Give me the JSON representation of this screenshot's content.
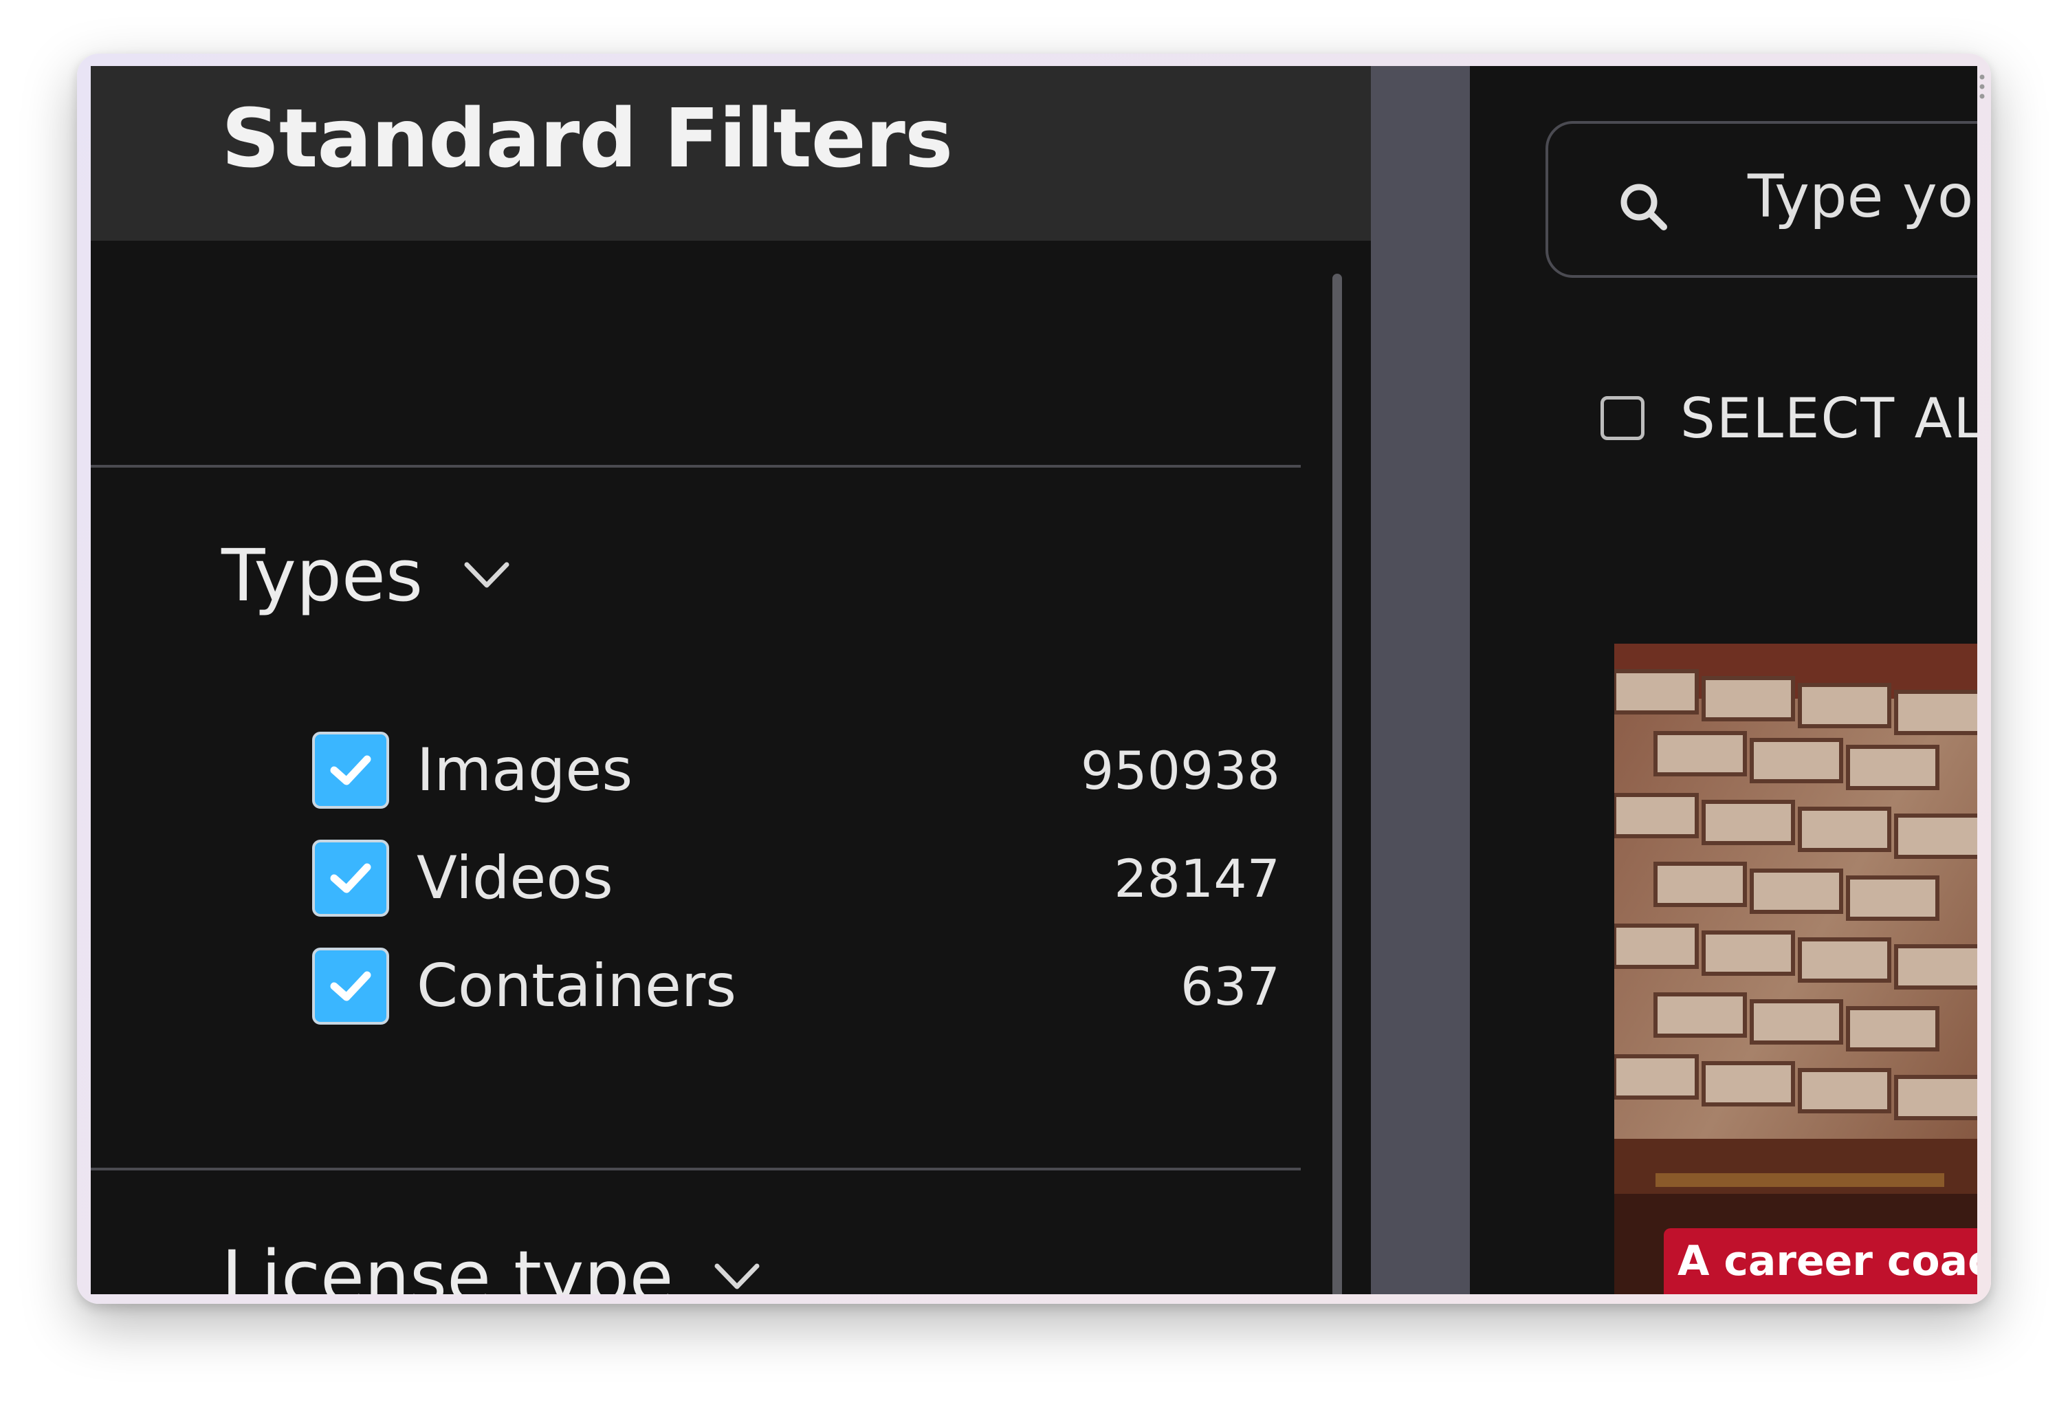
{
  "filters": {
    "title": "Standard Filters",
    "sections": [
      {
        "title": "Types",
        "items": [
          {
            "label": "Images",
            "count": "950938",
            "checked": true
          },
          {
            "label": "Videos",
            "count": "28147",
            "checked": true
          },
          {
            "label": "Containers",
            "count": "637",
            "checked": true
          }
        ]
      },
      {
        "title": "License type"
      }
    ]
  },
  "search": {
    "placeholder": "Type you",
    "icon": "search-icon"
  },
  "selection": {
    "select_all_label": "SELECT ALL"
  },
  "results": {
    "first_thumbnail_caption": "A career coach s"
  },
  "colors": {
    "background": "#131313",
    "header": "#2b2b2b",
    "checkbox_accent": "#3ab6ff",
    "caption_red": "#c0112c"
  }
}
